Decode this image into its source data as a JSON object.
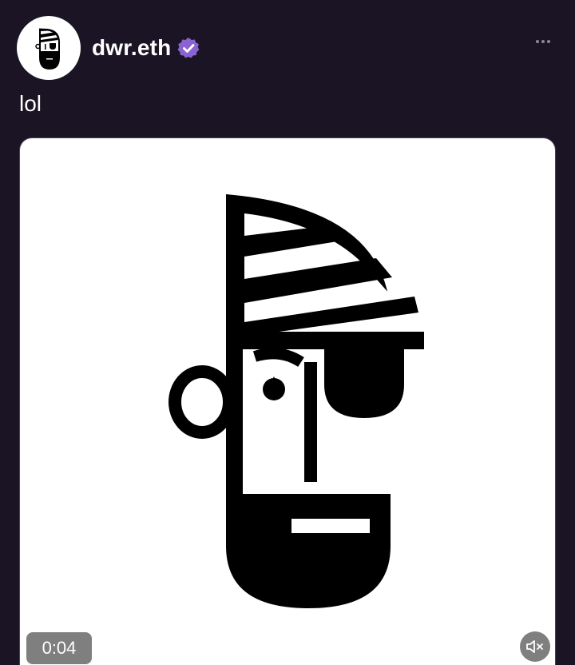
{
  "author": {
    "username": "dwr.eth",
    "verified": true,
    "avatar_icon": "pirate-face-avatar"
  },
  "post": {
    "text": "lol"
  },
  "video": {
    "timestamp": "0:04",
    "muted": true
  },
  "colors": {
    "background": "#1a1424",
    "verified_badge": "#8a63d2",
    "media_background": "#ffffff",
    "overlay": "#696969"
  }
}
